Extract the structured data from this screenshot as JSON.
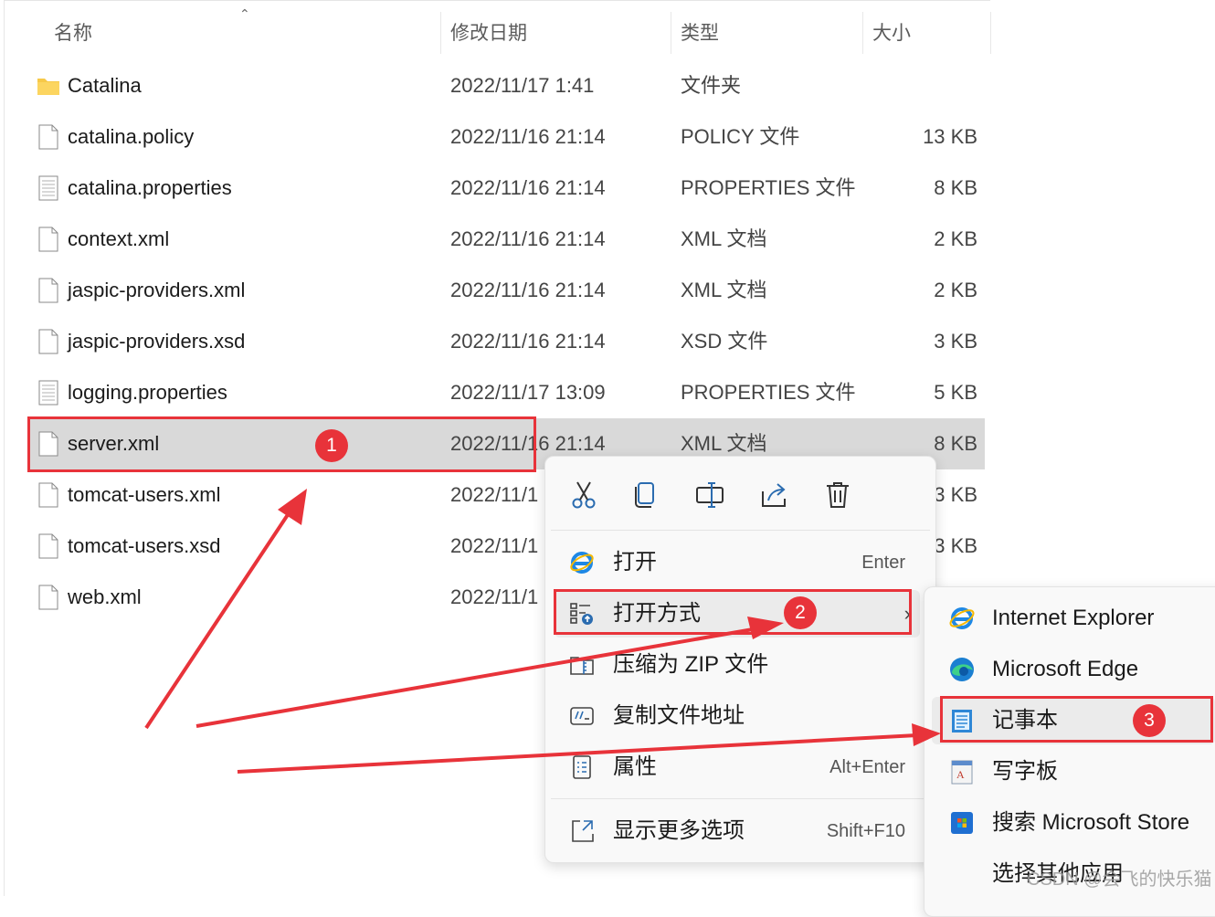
{
  "columns": {
    "name": "名称",
    "date": "修改日期",
    "type": "类型",
    "size": "大小"
  },
  "files": [
    {
      "name": "Catalina",
      "date": "2022/11/17 1:41",
      "type": "文件夹",
      "size": "",
      "icon": "folder-icon"
    },
    {
      "name": "catalina.policy",
      "date": "2022/11/16 21:14",
      "type": "POLICY 文件",
      "size": "13 KB",
      "icon": "file-icon"
    },
    {
      "name": "catalina.properties",
      "date": "2022/11/16 21:14",
      "type": "PROPERTIES 文件",
      "size": "8 KB",
      "icon": "text-file-icon"
    },
    {
      "name": "context.xml",
      "date": "2022/11/16 21:14",
      "type": "XML 文档",
      "size": "2 KB",
      "icon": "file-icon"
    },
    {
      "name": "jaspic-providers.xml",
      "date": "2022/11/16 21:14",
      "type": "XML 文档",
      "size": "2 KB",
      "icon": "file-icon"
    },
    {
      "name": "jaspic-providers.xsd",
      "date": "2022/11/16 21:14",
      "type": "XSD 文件",
      "size": "3 KB",
      "icon": "file-icon"
    },
    {
      "name": "logging.properties",
      "date": "2022/11/17 13:09",
      "type": "PROPERTIES 文件",
      "size": "5 KB",
      "icon": "text-file-icon"
    },
    {
      "name": "server.xml",
      "date": "2022/11/16 21:14",
      "type": "XML 文档",
      "size": "8 KB",
      "icon": "file-icon"
    },
    {
      "name": "tomcat-users.xml",
      "date": "2022/11/1",
      "type": "",
      "size": "3 KB",
      "icon": "file-icon"
    },
    {
      "name": "tomcat-users.xsd",
      "date": "2022/11/1",
      "type": "",
      "size": "3 KB",
      "icon": "file-icon"
    },
    {
      "name": "web.xml",
      "date": "2022/11/1",
      "type": "",
      "size": "",
      "icon": "file-icon"
    }
  ],
  "context_menu": {
    "toolbar": [
      "cut-icon",
      "copy-icon",
      "rename-icon",
      "share-icon",
      "delete-icon"
    ],
    "items": [
      {
        "label": "打开",
        "shortcut": "Enter",
        "icon": "internet-explorer-icon"
      },
      {
        "label": "打开方式",
        "shortcut": "",
        "icon": "open-with-icon"
      },
      {
        "label": "压缩为 ZIP 文件",
        "shortcut": "",
        "icon": "zip-icon"
      },
      {
        "label": "复制文件地址",
        "shortcut": "",
        "icon": "copy-path-icon"
      },
      {
        "label": "属性",
        "shortcut": "Alt+Enter",
        "icon": "properties-icon"
      },
      {
        "label": "显示更多选项",
        "shortcut": "Shift+F10",
        "icon": "more-options-icon"
      }
    ]
  },
  "submenu": {
    "items": [
      {
        "label": "Internet Explorer",
        "icon": "internet-explorer-icon"
      },
      {
        "label": "Microsoft Edge",
        "icon": "edge-icon"
      },
      {
        "label": "记事本",
        "icon": "notepad-icon"
      },
      {
        "label": "写字板",
        "icon": "wordpad-icon"
      },
      {
        "label": "搜索 Microsoft Store",
        "icon": "store-icon"
      },
      {
        "label": "选择其他应用",
        "icon": ""
      }
    ]
  },
  "annotations": {
    "badge1": "1",
    "badge2": "2",
    "badge3": "3",
    "color": "#e8333a"
  },
  "watermark": "CSDN @会飞的快乐猫"
}
